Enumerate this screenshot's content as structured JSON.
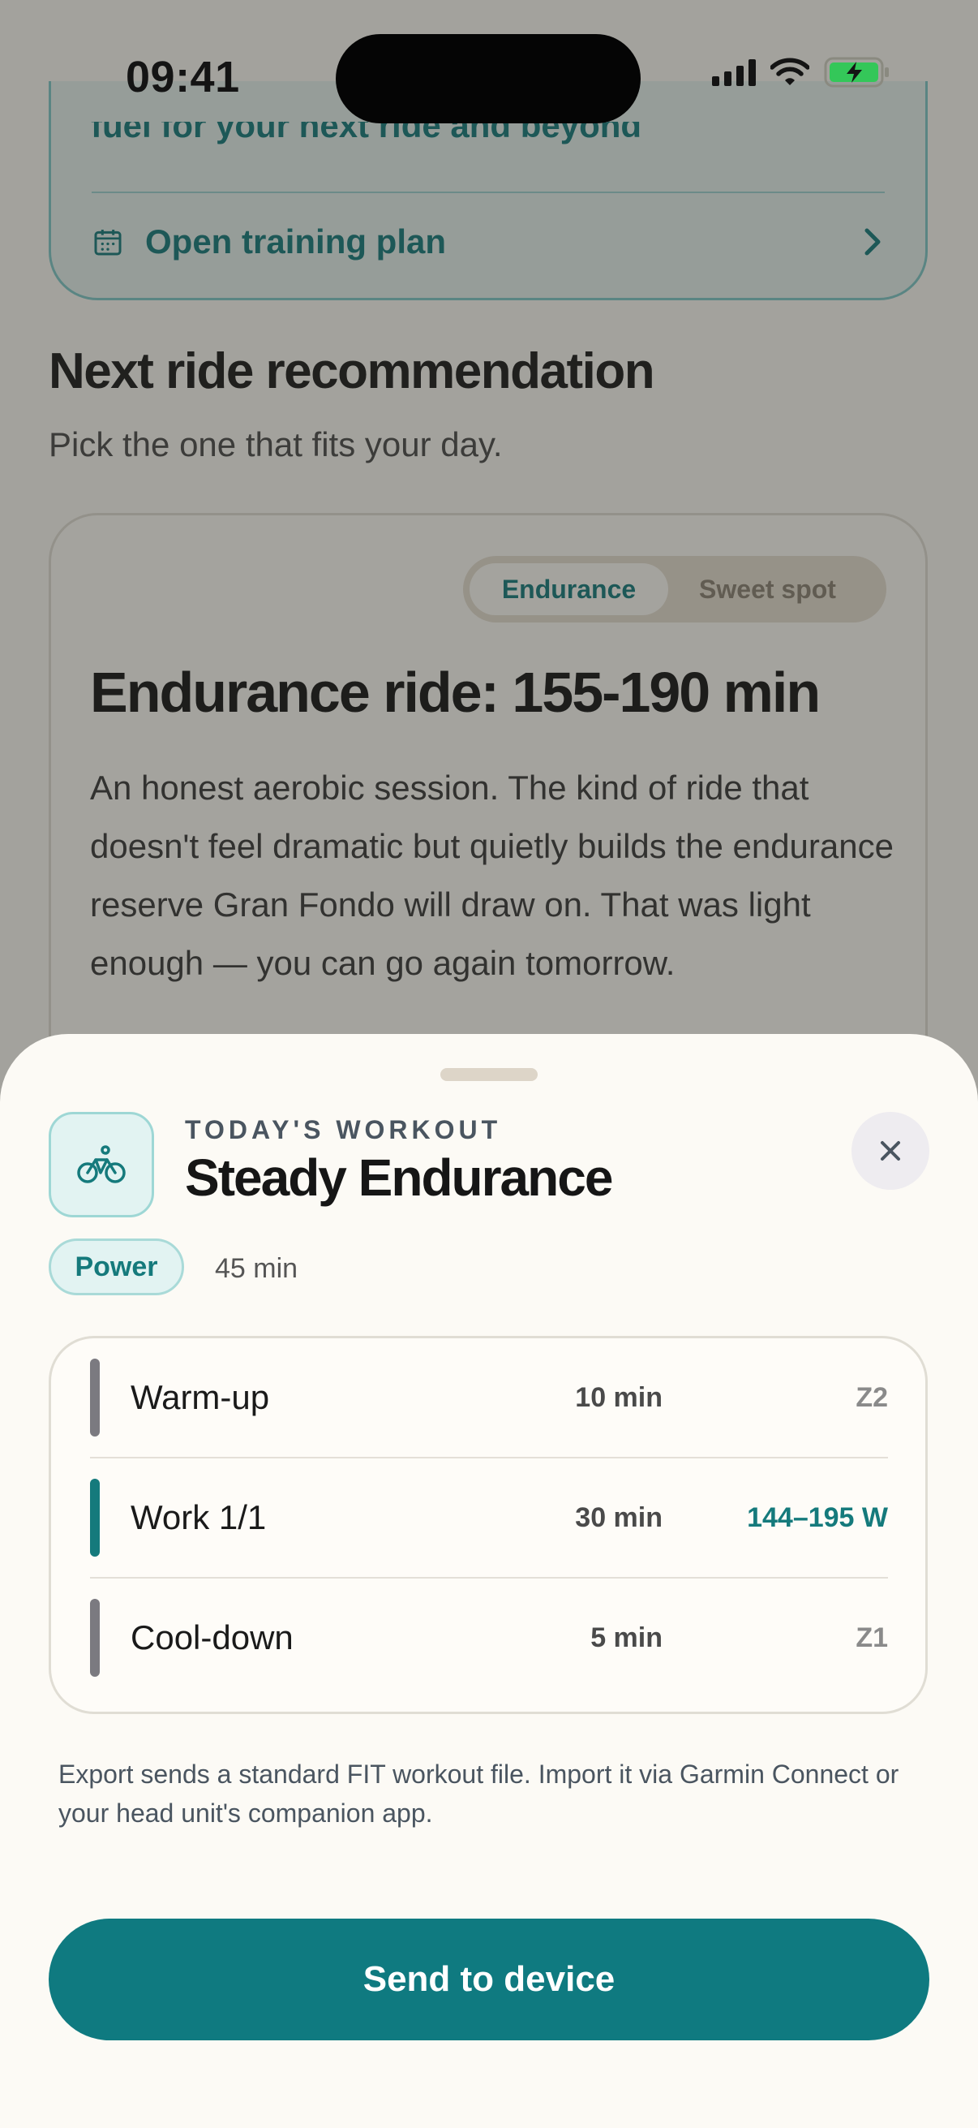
{
  "status_bar": {
    "time": "09:41"
  },
  "background": {
    "plan_card": {
      "partial_text": "fuel for your next ride and beyond",
      "open_plan_label": "Open training plan"
    },
    "section": {
      "title": "Next ride recommendation",
      "subtitle": "Pick the one that fits your day."
    },
    "recommendation": {
      "segments": [
        {
          "label": "Endurance",
          "selected": true
        },
        {
          "label": "Sweet spot",
          "selected": false
        }
      ],
      "title": "Endurance ride: 155-190 min",
      "body": "An honest aerobic session. The kind of ride that doesn't feel dramatic but quietly builds the endurance reserve Gran Fondo will draw on. That was light enough — you can go again tomorrow."
    }
  },
  "sheet": {
    "icon": "bicycle-icon",
    "eyebrow": "TODAY'S WORKOUT",
    "title": "Steady Endurance",
    "close_icon": "close-icon",
    "mode_pill": "Power",
    "duration": "45 min",
    "steps": [
      {
        "name": "Warm-up",
        "duration": "10 min",
        "target": "Z2",
        "accent": false
      },
      {
        "name": "Work 1/1",
        "duration": "30 min",
        "target": "144–195 W",
        "accent": true
      },
      {
        "name": "Cool-down",
        "duration": "5 min",
        "target": "Z1",
        "accent": false
      }
    ],
    "export_note": "Export sends a standard FIT workout file. Import it via Garmin Connect or your head unit's companion app.",
    "send_button": "Send to device"
  },
  "colors": {
    "accent": "#0F7A80",
    "accent_text": "#157A7C",
    "sheet_bg": "#FCFAF5",
    "battery_green": "#34C759"
  }
}
